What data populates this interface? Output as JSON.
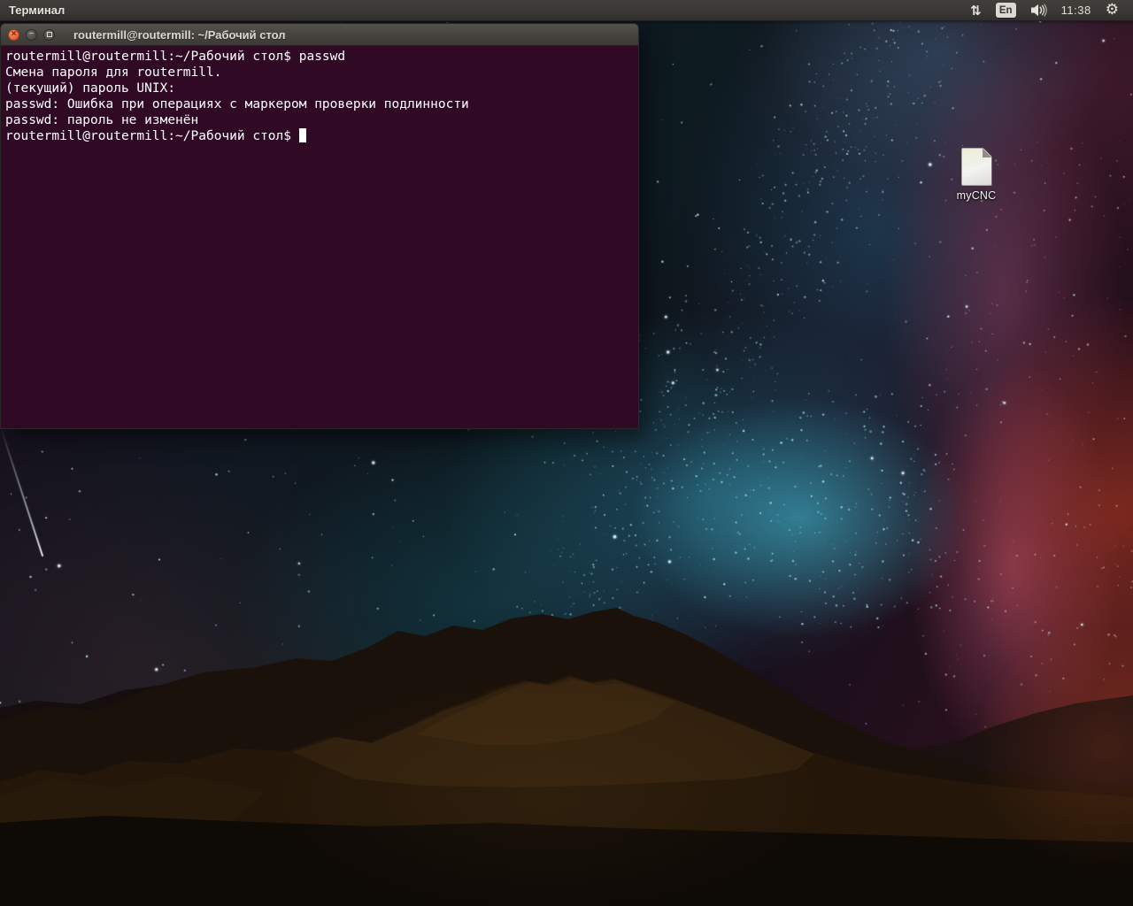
{
  "panel": {
    "app_name": "Терминал",
    "keyboard_indicator_icon": "⇅",
    "keyboard_layout": "En",
    "volume_icon_name": "speaker-with-waves",
    "clock": "11:38",
    "session_icon": "⚙"
  },
  "terminal_window": {
    "title": "routermill@routermill: ~/Рабочий стол",
    "window_buttons": {
      "close": "×",
      "minimize": "−",
      "maximize": "□"
    },
    "lines": [
      "routermill@routermill:~/Рабочий стол$ passwd",
      "Смена пароля для routermill.",
      "(текущий) пароль UNIX:",
      "passwd: Ошибка при операциях с маркером проверки подлинности",
      "passwd: пароль не изменён"
    ],
    "prompt_line": "routermill@routermill:~/Рабочий стол$",
    "colors": {
      "terminal_background": "#300A24",
      "terminal_text": "#FFFFFF",
      "titlebar": "#47453F",
      "panel_background": "#3A3834",
      "close_button_orange": "#EF6C3E"
    }
  },
  "desktop": {
    "icons": [
      {
        "label": "myCNC"
      }
    ]
  }
}
